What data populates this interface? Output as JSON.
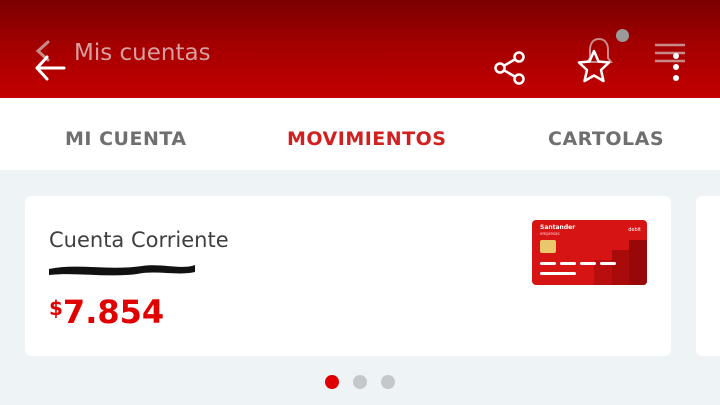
{
  "header": {
    "title": "Mis cuentas",
    "color": "#a30000"
  },
  "tabs": [
    {
      "label": "MI CUENTA",
      "active": false
    },
    {
      "label": "MOVIMIENTOS",
      "active": true
    },
    {
      "label": "CARTOLAS",
      "active": false
    }
  ],
  "account": {
    "name": "Cuenta Corriente",
    "currency_symbol": "$",
    "balance": "7.854",
    "accent_color": "#e00000"
  },
  "bank_card": {
    "brand": "Santander",
    "subtitle": "empresas",
    "type": "debit"
  },
  "pager": {
    "total": 3,
    "active_index": 0,
    "active_color": "#e00000",
    "inactive_color": "#c4c8cc"
  },
  "icons": [
    "back-arrow-icon",
    "share-icon",
    "favorite-star-icon",
    "bell-icon",
    "menu-icon",
    "more-vertical-icon"
  ]
}
